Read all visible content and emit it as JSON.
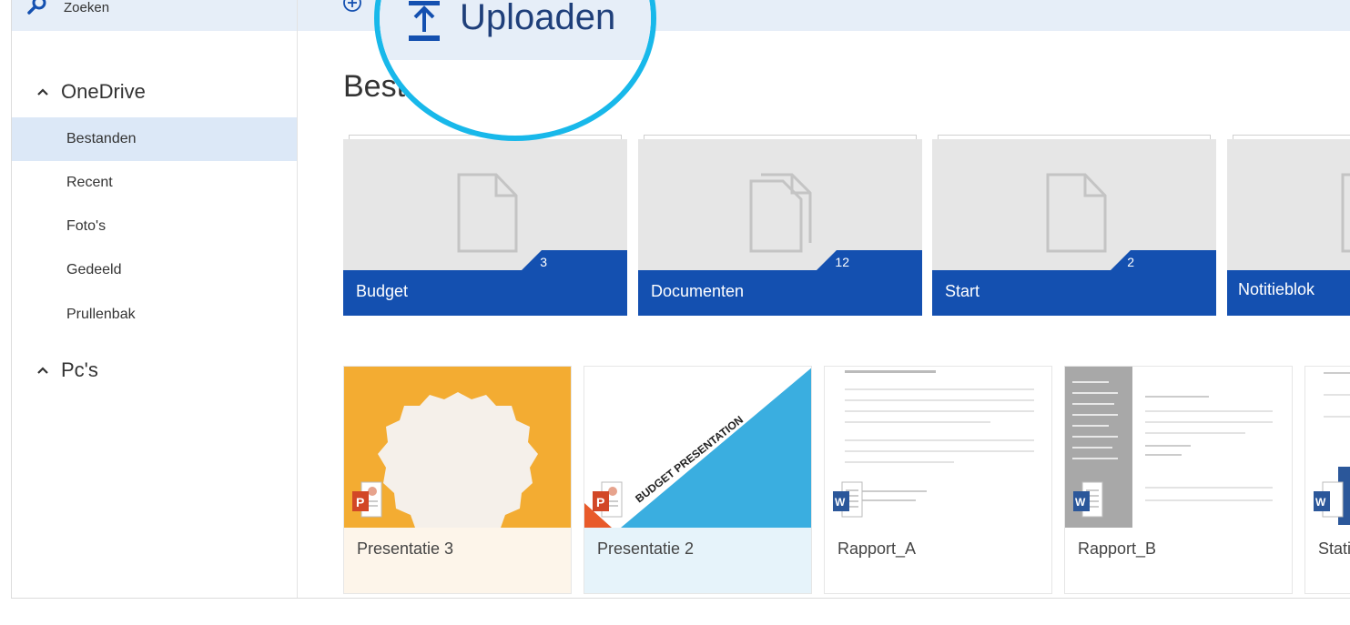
{
  "sidebar": {
    "search_label": "Zoeken",
    "onedrive_label": "OneDrive",
    "items": [
      {
        "label": "Bestanden",
        "active": true
      },
      {
        "label": "Recent",
        "active": false
      },
      {
        "label": "Foto's",
        "active": false
      },
      {
        "label": "Gedeeld",
        "active": false
      },
      {
        "label": "Prullenbak",
        "active": false
      }
    ],
    "pcs_label": "Pc's"
  },
  "command": {
    "upload_label": "Uploaden",
    "new_icon": "plus-circle-icon",
    "upload_icon": "upload-icon"
  },
  "main": {
    "title": "Bestanden"
  },
  "folders": [
    {
      "name": "Budget",
      "count": "3",
      "icon": "single-doc"
    },
    {
      "name": "Documenten",
      "count": "12",
      "icon": "multi-doc"
    },
    {
      "name": "Start",
      "count": "2",
      "icon": "single-doc"
    },
    {
      "name": "Notitieblok",
      "count": "",
      "icon": "single-doc"
    }
  ],
  "files": [
    {
      "name": "Presentatie 3",
      "type": "powerpoint"
    },
    {
      "name": "Presentatie 2",
      "type": "powerpoint",
      "thumb_text": "BUDGET PRESENTATION"
    },
    {
      "name": "Rapport_A",
      "type": "word"
    },
    {
      "name": "Rapport_B",
      "type": "word"
    },
    {
      "name": "Statistieken",
      "type": "word"
    }
  ],
  "colors": {
    "accent": "#1450b0",
    "nav_active": "#dce8f7",
    "bar": "#e6eef8",
    "magnifier_ring": "#18b8ea",
    "ppt": "#d24726",
    "word": "#2b579a",
    "orange_tile": "#f3ac32",
    "blue_slide": "#3aaee0"
  }
}
